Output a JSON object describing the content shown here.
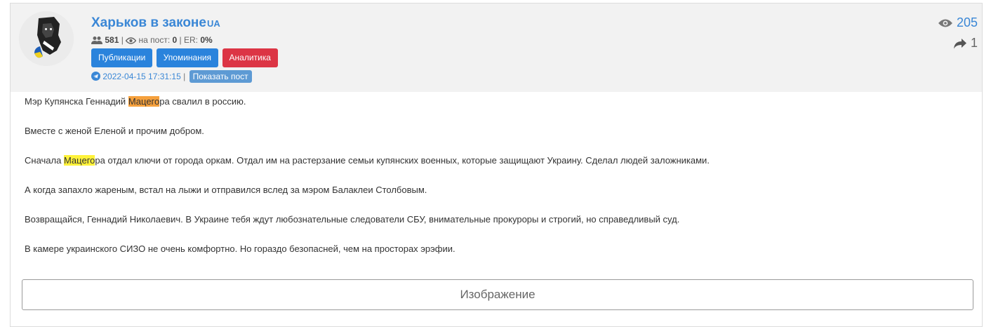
{
  "channel": {
    "name": "Харьков в законе",
    "suffix": "UA",
    "subscribers": "581",
    "per_post_label": "на пост:",
    "per_post_value": "0",
    "er_label": "ER:",
    "er_value": "0%"
  },
  "buttons": {
    "publications": "Публикации",
    "mentions": "Упоминания",
    "analytics": "Аналитика",
    "show_post": "Показать пост"
  },
  "post_meta": {
    "date": "2022-04-15 17:31:15",
    "separator": "|"
  },
  "counters": {
    "views": "205",
    "shares": "1"
  },
  "post": {
    "p1_before": "Мэр Купянска Геннадий ",
    "p1_mark": "Мацего",
    "p1_after": "ра свалил в россию.",
    "p2": "Вместе с женой Еленой и прочим добром.",
    "p3_before": "Сначала ",
    "p3_mark": "Мацего",
    "p3_after": "ра отдал ключи от города оркам. Отдал им на растерзание семьи купянских военных, которые защищают Украину. Сделал людей заложниками.",
    "p4": "А когда запахло жареным, встал на лыжи и отправился вслед за мэром Балаклеи Столбовым.",
    "p5": "Возвращайся, Геннадий Николаевич. В Украине тебя ждут любознательные следователи СБУ, внимательные прокуроры и строгий, но справедливый суд.",
    "p6": "В камере украинского СИЗО не очень комфортно. Но гораздо безопасней, чем на просторах эрэфии."
  },
  "image_button": "Изображение",
  "colors": {
    "link_blue": "#3a87d6",
    "button_blue": "#2a83dc",
    "button_red": "#dc3545",
    "highlight_orange": "#f5a03c",
    "highlight_yellow": "#fff23a"
  }
}
